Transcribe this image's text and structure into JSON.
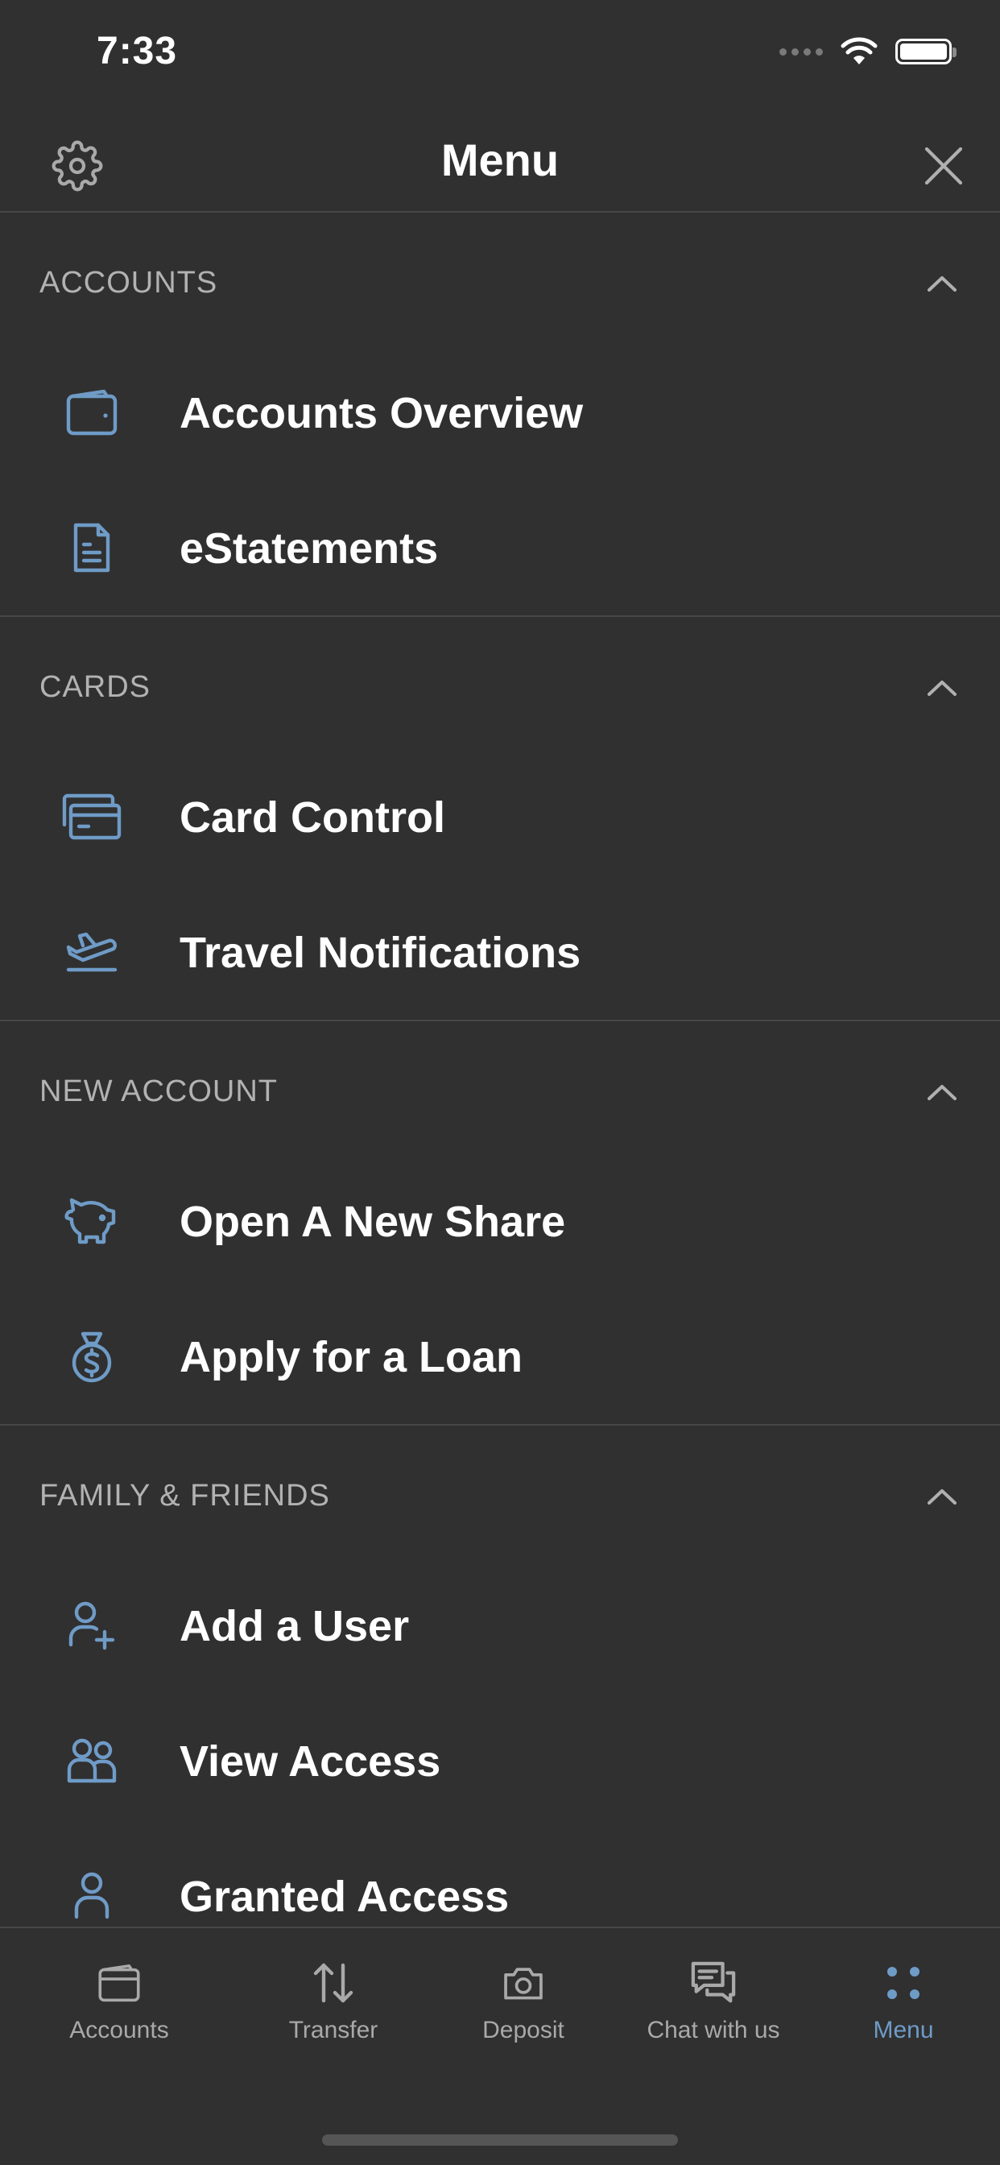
{
  "status_bar": {
    "time": "7:33"
  },
  "header": {
    "title": "Menu",
    "settings_icon": "gear-icon",
    "close_icon": "close-icon"
  },
  "colors": {
    "background": "#303030",
    "accent": "#6f9bc7",
    "divider": "#474747",
    "section_title": "#b2b2b2"
  },
  "sections": [
    {
      "title": "ACCOUNTS",
      "items": [
        {
          "label": "Accounts Overview",
          "icon": "wallet-icon"
        },
        {
          "label": "eStatements",
          "icon": "document-icon"
        }
      ]
    },
    {
      "title": "CARDS",
      "items": [
        {
          "label": "Card Control",
          "icon": "cards-icon"
        },
        {
          "label": "Travel Notifications",
          "icon": "airplane-icon"
        }
      ]
    },
    {
      "title": "NEW ACCOUNT",
      "items": [
        {
          "label": "Open A New Share",
          "icon": "piggy-bank-icon"
        },
        {
          "label": "Apply for a Loan",
          "icon": "money-bag-icon"
        }
      ]
    },
    {
      "title": "FAMILY & FRIENDS",
      "items": [
        {
          "label": "Add a User",
          "icon": "add-user-icon"
        },
        {
          "label": "View Access",
          "icon": "users-icon"
        },
        {
          "label": "Granted Access",
          "icon": "user-icon"
        }
      ]
    }
  ],
  "bottom_nav": {
    "items": [
      {
        "label": "Accounts",
        "icon": "wallet-icon"
      },
      {
        "label": "Transfer",
        "icon": "transfer-arrows-icon"
      },
      {
        "label": "Deposit",
        "icon": "camera-icon"
      },
      {
        "label": "Chat with us",
        "icon": "chat-icon"
      },
      {
        "label": "Menu",
        "icon": "menu-dots-icon",
        "active": true
      }
    ]
  }
}
